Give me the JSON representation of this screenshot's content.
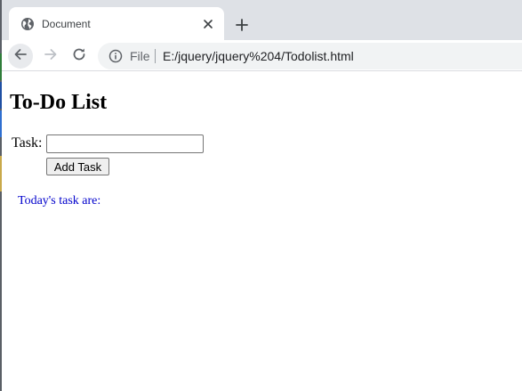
{
  "browser": {
    "tab_title": "Document",
    "omnibox": {
      "scheme_label": "File",
      "url": "E:/jquery/jquery%204/Todolist.html"
    },
    "icons": {
      "favicon": "globe-icon",
      "close": "close-icon",
      "new_tab": "plus-icon",
      "back": "back-arrow-icon",
      "forward": "forward-arrow-icon",
      "reload": "reload-icon",
      "site_info": "info-icon"
    }
  },
  "page": {
    "heading": "To-Do List",
    "task_label": "Task:",
    "task_input": {
      "value": "",
      "placeholder": ""
    },
    "add_button_label": "Add Task",
    "today_label": "Today's task are:",
    "today_label_color": "#0000cc"
  }
}
